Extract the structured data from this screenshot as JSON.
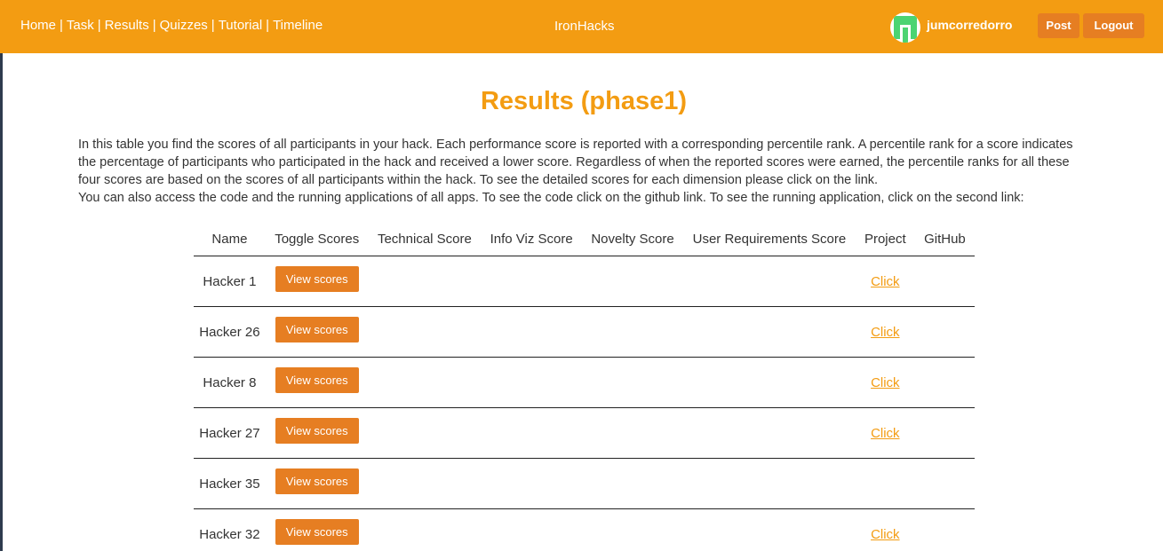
{
  "nav": {
    "links": [
      "Home",
      "Task",
      "Results",
      "Quizzes",
      "Tutorial",
      "Timeline"
    ],
    "separator": "|",
    "brand": "IronHacks",
    "username": "jumcorredorro",
    "post_label": "Post",
    "logout_label": "Logout",
    "avatar_icon": "user-identicon",
    "bar_color": "#f39c12",
    "button_color": "#e67e22"
  },
  "page": {
    "title": "Results (phase1)",
    "intro_p1": "In this table you find the scores of all participants in your hack. Each performance score is reported with a corresponding percentile rank. A percentile rank for a score indicates the percentage of participants who participated in the hack and received a lower score. Regardless of when the reported scores were earned, the percentile ranks for all these four scores are based on the scores of all participants within the hack. To see the detailed scores for each dimension please click on the link.",
    "intro_p2": "You can also access the code and the running applications of all apps. To see the code click on the github link. To see the running application, click on the second link:"
  },
  "table": {
    "headers": [
      "Name",
      "Toggle Scores",
      "Technical Score",
      "Info Viz Score",
      "Novelty Score",
      "User Requirements Score",
      "Project",
      "GitHub"
    ],
    "rows": [
      {
        "name": "Hacker 1",
        "toggle": "View scores",
        "project": "Click"
      },
      {
        "name": "Hacker 26",
        "toggle": "View scores",
        "project": "Click"
      },
      {
        "name": "Hacker 8",
        "toggle": "View scores",
        "project": "Click"
      },
      {
        "name": "Hacker 27",
        "toggle": "View scores",
        "project": "Click"
      },
      {
        "name": "Hacker 35",
        "toggle": "View scores",
        "project": ""
      },
      {
        "name": "Hacker 32",
        "toggle": "View scores",
        "project": "Click"
      }
    ]
  }
}
